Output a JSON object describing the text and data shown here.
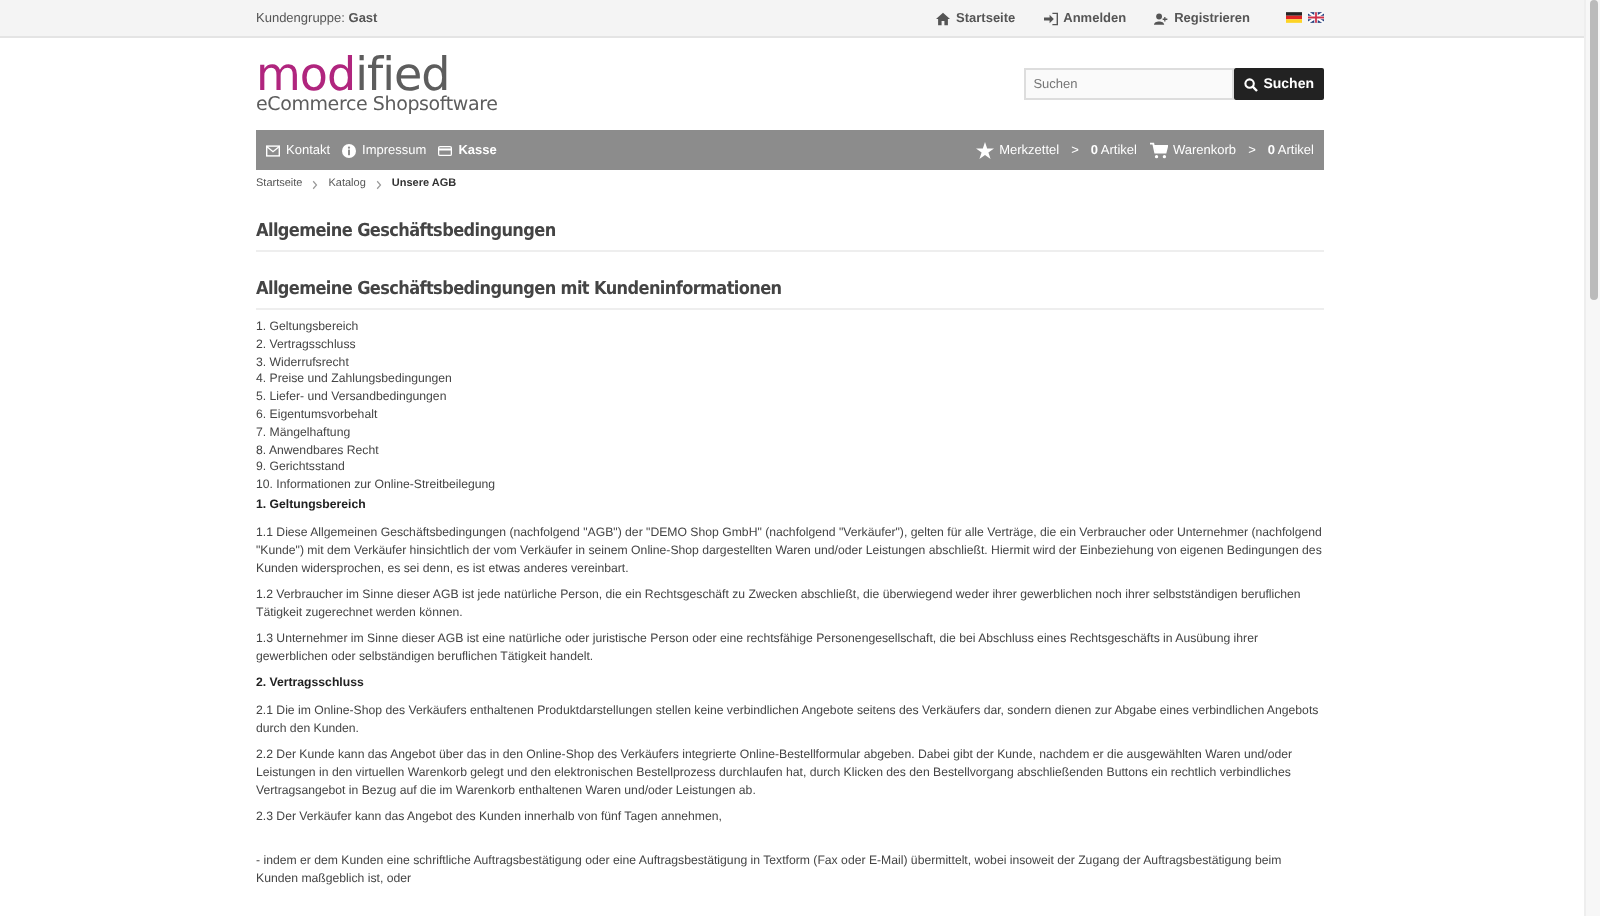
{
  "top_bar": {
    "customer_group_label": "Kundengruppe:",
    "customer_group_value": "Gast",
    "links": [
      {
        "label": "Startseite"
      },
      {
        "label": "Anmelden"
      },
      {
        "label": "Registrieren"
      }
    ]
  },
  "header": {
    "logo": {
      "highlight": "mod",
      "rest": "ified",
      "tagline": "eCommerce Shopsoftware"
    },
    "search": {
      "placeholder": "Suchen",
      "button": "Suchen"
    }
  },
  "nav_bar": {
    "left": [
      {
        "label": "Kontakt",
        "emphasized": false
      },
      {
        "label": "Impressum",
        "emphasized": false
      },
      {
        "label": "Kasse",
        "emphasized": true
      }
    ],
    "right": [
      {
        "label": "Merkzettel",
        "separator": ">",
        "count": "**0** Artikel"
      },
      {
        "label": "Warenkorb",
        "separator": ">",
        "count": "**0** Artikel"
      }
    ]
  },
  "breadcrumb": [
    {
      "label": "Startseite",
      "current": false
    },
    {
      "label": "Katalog",
      "current": false
    },
    {
      "label": "Unsere AGB",
      "current": true
    }
  ],
  "page_title": "Allgemeine Geschäftsbedingungen",
  "content": {
    "title": "Allgemeine Geschäftsbedingungen mit Kundeninformationen",
    "blocks": [
      {
        "kind": "toc",
        "items": [
          "1. Geltungsbereich",
          "2. Vertragsschluss",
          "3. Widerrufsrecht",
          "4. Preise und Zahlungsbedingungen",
          "5. Liefer-  und Versandbedingungen",
          "6. Eigentumsvorbehalt",
          "7. Mängelhaftung",
          "8. Anwendbares Recht",
          "9. Gerichtsstand",
          "10. Informationen zur Online-Streitbeilegung"
        ]
      },
      {
        "kind": "heading",
        "text": "1. Geltungsbereich"
      },
      {
        "kind": "paragraph",
        "text": "1.1 Diese Allgemeinen Geschäftsbedingungen (nachfolgend \"AGB\") der \"DEMO Shop GmbH\" (nachfolgend \"Verkäufer\"), gelten für alle Verträge, die ein Verbraucher oder Unternehmer (nachfolgend \"Kunde\") mit dem Verkäufer hinsichtlich der vom Verkäufer in seinem Online-Shop dargestellten Waren und/oder Leistungen abschließt. Hiermit wird der Einbeziehung von eigenen Bedingungen des Kunden widersprochen, es sei denn, es ist etwas anderes vereinbart."
      },
      {
        "kind": "paragraph",
        "text": "1.2 Verbraucher im Sinne dieser AGB ist jede natürliche Person, die ein Rechtsgeschäft zu Zwecken abschließt, die überwiegend weder ihrer gewerblichen noch ihrer selbstständigen beruflichen Tätigkeit zugerechnet werden können."
      },
      {
        "kind": "paragraph",
        "text": "1.3 Unternehmer im Sinne dieser AGB ist eine natürliche oder juristische Person oder eine rechtsfähige Personengesellschaft, die bei Abschluss eines Rechtsgeschäfts in Ausübung ihrer gewerblichen oder selbständigen beruflichen Tätigkeit handelt."
      },
      {
        "kind": "heading",
        "text": "2. Vertragsschluss"
      },
      {
        "kind": "paragraph",
        "text": "2.1 Die im Online-Shop des Verkäufers enthaltenen Produktdarstellungen stellen keine verbindlichen Angebote seitens des Verkäufers dar, sondern dienen zur Abgabe eines verbindlichen Angebots durch den Kunden."
      },
      {
        "kind": "paragraph",
        "text": "2.2 Der Kunde kann das Angebot über das in den Online-Shop des Verkäufers integrierte Online-Bestellformular abgeben. Dabei gibt der Kunde, nachdem er die ausgewählten Waren und/oder Leistungen in den virtuellen Warenkorb gelegt und den elektronischen Bestellprozess durchlaufen hat, durch Klicken des den Bestellvorgang abschließenden Buttons ein rechtlich verbindliches Vertragsangebot in Bezug auf die im Warenkorb enthaltenen Waren und/oder Leistungen ab."
      },
      {
        "kind": "paragraph",
        "text": "2.3 Der Verkäufer kann das Angebot des Kunden innerhalb von fünf Tagen annehmen,"
      },
      {
        "kind": "spacer"
      },
      {
        "kind": "paragraph",
        "text": "- indem er dem Kunden eine schriftliche Auftragsbestätigung oder eine Auftragsbestätigung in Textform (Fax oder E-Mail) übermittelt, wobei insoweit der Zugang der Auftragsbestätigung beim Kunden maßgeblich ist, oder"
      }
    ]
  }
}
